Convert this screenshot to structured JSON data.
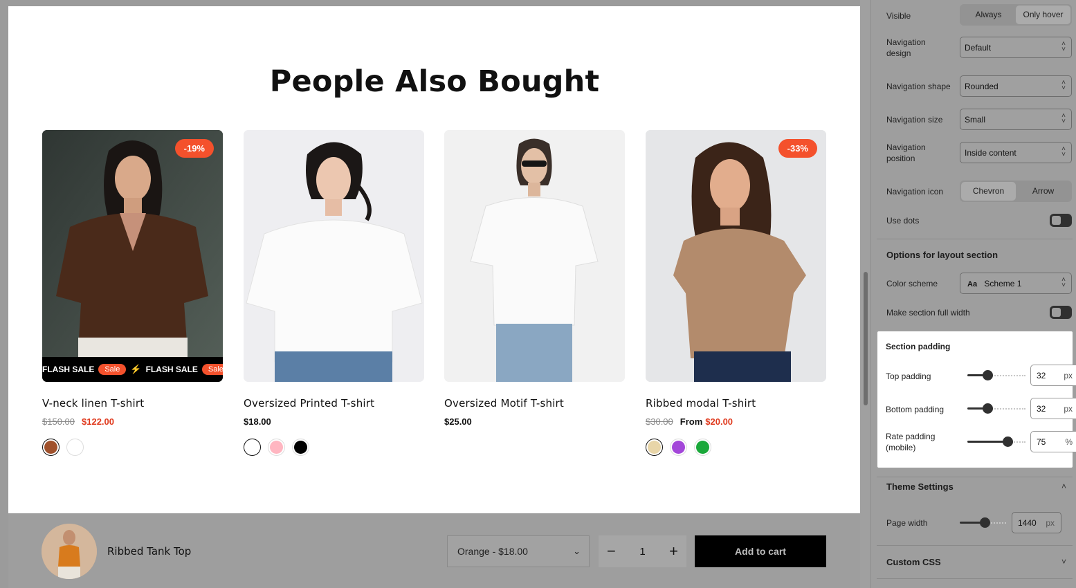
{
  "preview": {
    "section_title": "People Also Bought",
    "products": [
      {
        "name": "V-neck linen T-shirt",
        "old_price": "$150.00",
        "price": "$122.00",
        "badge": "-19%",
        "flash_text": "FLASH SALE",
        "flash_pill": "Sale",
        "swatches": [
          "#a0522d",
          "#ffffff"
        ],
        "active_swatch": 0
      },
      {
        "name": "Oversized Printed T-shirt",
        "price": "$18.00",
        "swatches": [
          "#ffffff",
          "#ffb6c1",
          "#000000"
        ],
        "active_swatch": 0
      },
      {
        "name": "Oversized Motif T-shirt",
        "price": "$25.00",
        "swatches": []
      },
      {
        "name": "Ribbed modal T-shirt",
        "old_price": "$30.00",
        "from_label": "From",
        "price": "$20.00",
        "badge": "-33%",
        "swatches": [
          "#e8d5a8",
          "#a347d9",
          "#1aa83a"
        ],
        "active_swatch": 0
      }
    ]
  },
  "sticky_bar": {
    "product_name": "Ribbed Tank Top",
    "variant": "Orange - $18.00",
    "quantity": "1",
    "minus": "−",
    "plus": "+",
    "add_to_cart": "Add to cart"
  },
  "panel": {
    "visible_label": "Visible",
    "visible_options": [
      "Always",
      "Only hover"
    ],
    "visible_selected": 1,
    "nav_design_label": "Navigation design",
    "nav_design_value": "Default",
    "nav_shape_label": "Navigation shape",
    "nav_shape_value": "Rounded",
    "nav_size_label": "Navigation size",
    "nav_size_value": "Small",
    "nav_position_label": "Navigation position",
    "nav_position_value": "Inside content",
    "nav_icon_label": "Navigation icon",
    "nav_icon_options": [
      "Chevron",
      "Arrow"
    ],
    "nav_icon_selected": 0,
    "use_dots_label": "Use dots",
    "use_dots_on": false,
    "layout_heading": "Options for layout section",
    "color_scheme_label": "Color scheme",
    "color_scheme_value": "Scheme 1",
    "full_width_label": "Make section full width",
    "full_width_on": false,
    "padding_heading": "Section padding",
    "top_padding_label": "Top padding",
    "top_padding_value": "32",
    "top_padding_unit": "px",
    "bottom_padding_label": "Bottom padding",
    "bottom_padding_value": "32",
    "bottom_padding_unit": "px",
    "rate_padding_label": "Rate padding (mobile)",
    "rate_padding_value": "75",
    "rate_padding_unit": "%",
    "theme_heading": "Theme Settings",
    "page_width_label": "Page width",
    "page_width_value": "1440",
    "page_width_unit": "px",
    "custom_css_heading": "Custom CSS"
  }
}
